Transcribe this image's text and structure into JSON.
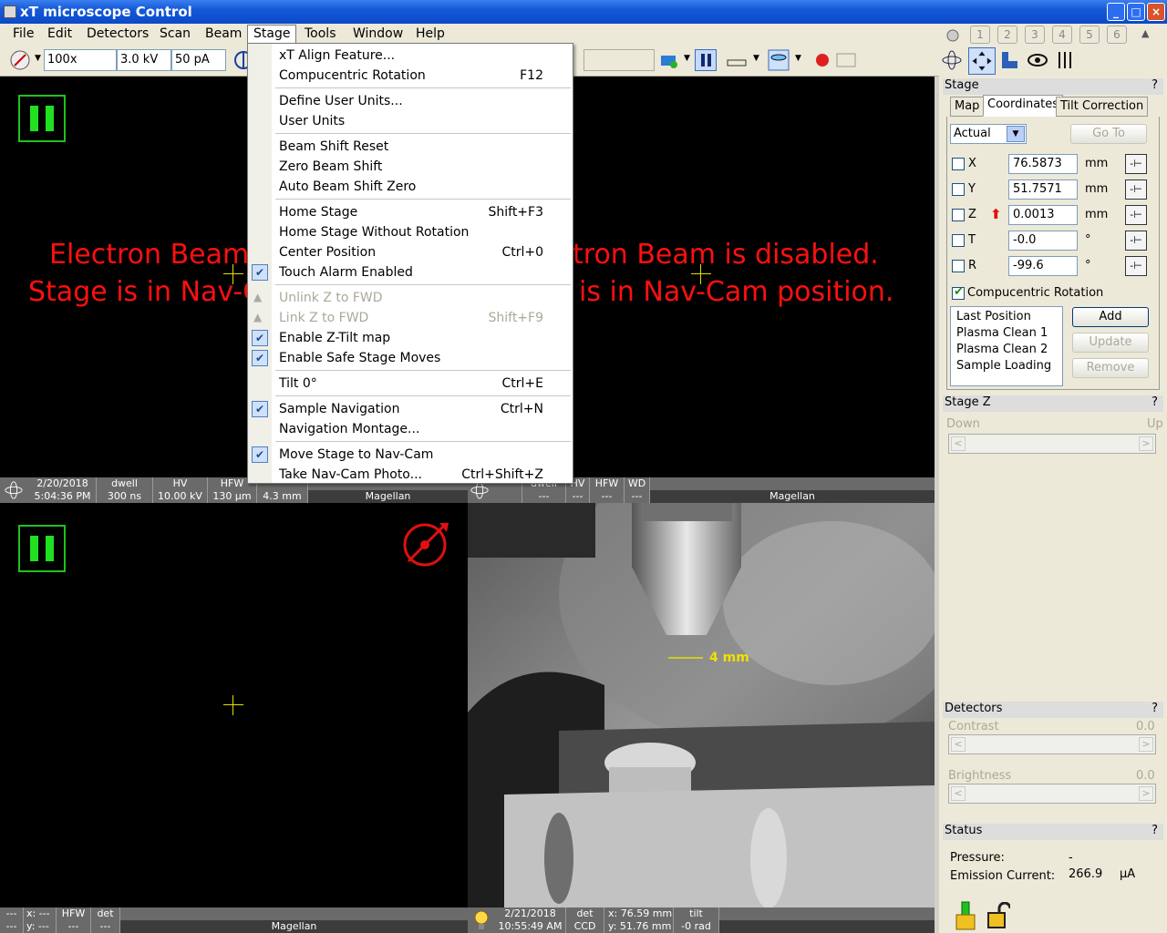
{
  "window": {
    "title": "xT microscope Control"
  },
  "menubar": [
    "File",
    "Edit",
    "Detectors",
    "Scan",
    "Beam",
    "Stage",
    "Tools",
    "Window",
    "Help"
  ],
  "toolbar": {
    "magnification": "100x",
    "hv": "3.0 kV",
    "current": "50 pA"
  },
  "numtabs": [
    "1",
    "2",
    "3",
    "4",
    "5",
    "6"
  ],
  "stage_menu": [
    {
      "label": "xT Align Feature...",
      "shortcut": "",
      "checked": false,
      "disabled": false,
      "sep_after": false
    },
    {
      "label": "Compucentric Rotation",
      "shortcut": "F12",
      "checked": false,
      "disabled": false,
      "sep_after": true
    },
    {
      "label": "Define User Units...",
      "shortcut": "",
      "checked": false,
      "disabled": false,
      "sep_after": false
    },
    {
      "label": "User Units",
      "shortcut": "",
      "checked": false,
      "disabled": false,
      "sep_after": true
    },
    {
      "label": "Beam Shift Reset",
      "shortcut": "",
      "checked": false,
      "disabled": false,
      "sep_after": false
    },
    {
      "label": "Zero Beam Shift",
      "shortcut": "",
      "checked": false,
      "disabled": false,
      "sep_after": false
    },
    {
      "label": "Auto Beam Shift Zero",
      "shortcut": "",
      "checked": false,
      "disabled": false,
      "sep_after": true
    },
    {
      "label": "Home Stage",
      "shortcut": "Shift+F3",
      "checked": false,
      "disabled": false,
      "sep_after": false
    },
    {
      "label": "Home Stage Without Rotation",
      "shortcut": "",
      "checked": false,
      "disabled": false,
      "sep_after": false
    },
    {
      "label": "Center Position",
      "shortcut": "Ctrl+0",
      "checked": false,
      "disabled": false,
      "sep_after": false
    },
    {
      "label": "Touch Alarm Enabled",
      "shortcut": "",
      "checked": true,
      "disabled": false,
      "sep_after": true
    },
    {
      "label": "Unlink Z to FWD",
      "shortcut": "",
      "checked": false,
      "disabled": true,
      "sep_after": false
    },
    {
      "label": "Link Z to FWD",
      "shortcut": "Shift+F9",
      "checked": false,
      "disabled": true,
      "sep_after": false
    },
    {
      "label": "Enable Z-Tilt map",
      "shortcut": "",
      "checked": true,
      "disabled": false,
      "sep_after": false
    },
    {
      "label": "Enable Safe Stage Moves",
      "shortcut": "",
      "checked": true,
      "disabled": false,
      "sep_after": true
    },
    {
      "label": "Tilt 0°",
      "shortcut": "Ctrl+E",
      "checked": false,
      "disabled": false,
      "sep_after": true
    },
    {
      "label": "Sample Navigation",
      "shortcut": "Ctrl+N",
      "checked": true,
      "disabled": false,
      "sep_after": false
    },
    {
      "label": "Navigation Montage...",
      "shortcut": "",
      "checked": false,
      "disabled": false,
      "sep_after": true
    },
    {
      "label": "Move Stage to Nav-Cam",
      "shortcut": "",
      "checked": true,
      "disabled": false,
      "sep_after": false
    },
    {
      "label": "Take Nav-Cam Photo...",
      "shortcut": "Ctrl+Shift+Z",
      "checked": false,
      "disabled": false,
      "sep_after": false
    }
  ],
  "view1": {
    "msg_line1": "Electron Beam",
    "msg_line2": "Stage is in Nav-C"
  },
  "view2": {
    "msg_line1": "tron Beam is disabled.",
    "msg_line2": "is in Nav-Cam position."
  },
  "bar1": {
    "date": "2/20/2018",
    "time": "5:04:36 PM",
    "dwell_label": "dwell",
    "dwell": "300 ns",
    "hv_label": "HV",
    "hv": "10.00 kV",
    "hfw_label": "HFW",
    "hfw": "130 µm",
    "wd": "4.3 mm",
    "name": "Magellan"
  },
  "bar2": {
    "dwell_label": "dwell",
    "dwell": "---",
    "hv_label": "HV",
    "hv": "---",
    "hfw_label": "HFW",
    "hfw": "---",
    "wd_label": "WD",
    "wd": "---",
    "name": "Magellan"
  },
  "bar3": {
    "x_label": "x: ---",
    "y_label": "y: ---",
    "hfw_label": "HFW",
    "hfw": "---",
    "det_label": "det",
    "det": "---",
    "name": "Magellan"
  },
  "bar4": {
    "date": "2/21/2018",
    "time": "10:55:49 AM",
    "det_label": "det",
    "det": "CCD",
    "x": "x: 76.59 mm",
    "y": "y: 51.76 mm",
    "tilt_label": "tilt",
    "tilt": "-0 rad"
  },
  "navcam": {
    "scale": "4 mm"
  },
  "stage_panel": {
    "title": "Stage",
    "tabs": [
      "Map",
      "Coordinates",
      "Tilt Correction"
    ],
    "mode": "Actual",
    "goto": "Go To",
    "coords": [
      {
        "axis": "X",
        "value": "76.5873",
        "unit": "mm"
      },
      {
        "axis": "Y",
        "value": "51.7571",
        "unit": "mm"
      },
      {
        "axis": "Z",
        "value": "0.0013",
        "unit": "mm"
      },
      {
        "axis": "T",
        "value": "-0.0",
        "unit": "°"
      },
      {
        "axis": "R",
        "value": "-99.6",
        "unit": "°"
      }
    ],
    "compucentric": "Compucentric Rotation",
    "positions": [
      "Last Position",
      "Plasma Clean 1",
      "Plasma Clean 2",
      "Sample Loading"
    ],
    "add": "Add",
    "update": "Update",
    "remove": "Remove"
  },
  "stagez_panel": {
    "title": "Stage Z",
    "down": "Down",
    "up": "Up"
  },
  "detectors_panel": {
    "title": "Detectors",
    "contrast": "Contrast",
    "contrast_val": "0.0",
    "brightness": "Brightness",
    "brightness_val": "0.0"
  },
  "status_panel": {
    "title": "Status",
    "pressure_label": "Pressure:",
    "pressure": "-",
    "emission_label": "Emission Current:",
    "emission": "266.9",
    "emission_unit": "µA"
  },
  "colors": {
    "accent": "#1558d8",
    "message": "#ff1010",
    "pause": "#20e020"
  }
}
